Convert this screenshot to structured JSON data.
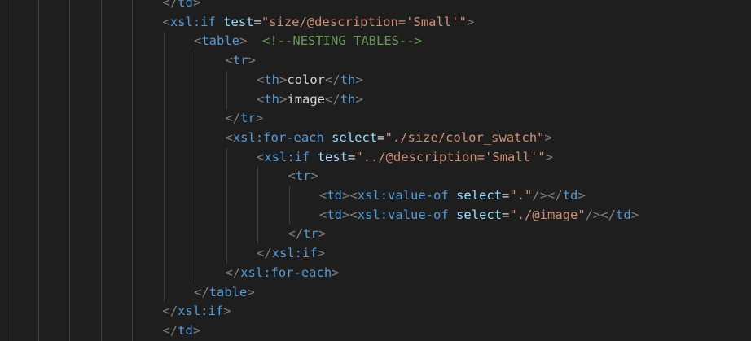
{
  "editor": {
    "language": "xsl",
    "colors": {
      "background": "#1e1e1e",
      "tag": "#569cd6",
      "bracket": "#808080",
      "attribute": "#9cdcfe",
      "string": "#ce9178",
      "comment": "#6a9955",
      "text": "#d4d4d4",
      "indent_guide": "#404040"
    },
    "lines": [
      {
        "indent": 6,
        "tokens": [
          [
            "br",
            "</"
          ],
          [
            "tag",
            "td"
          ],
          [
            "br",
            ">"
          ]
        ]
      },
      {
        "indent": 6,
        "tokens": [
          [
            "br",
            "<"
          ],
          [
            "tag",
            "xsl:if"
          ],
          [
            "txt",
            " "
          ],
          [
            "attr",
            "test"
          ],
          [
            "txt",
            "="
          ],
          [
            "str",
            "\"size/@description='Small'\""
          ],
          [
            "br",
            ">"
          ]
        ]
      },
      {
        "indent": 7,
        "tokens": [
          [
            "br",
            "<"
          ],
          [
            "tag",
            "table"
          ],
          [
            "br",
            ">"
          ],
          [
            "txt",
            "  "
          ],
          [
            "cmt",
            "<!--NESTING TABLES-->"
          ]
        ]
      },
      {
        "indent": 8,
        "tokens": [
          [
            "br",
            "<"
          ],
          [
            "tag",
            "tr"
          ],
          [
            "br",
            ">"
          ]
        ]
      },
      {
        "indent": 9,
        "tokens": [
          [
            "br",
            "<"
          ],
          [
            "tag",
            "th"
          ],
          [
            "br",
            ">"
          ],
          [
            "txt",
            "color"
          ],
          [
            "br",
            "</"
          ],
          [
            "tag",
            "th"
          ],
          [
            "br",
            ">"
          ]
        ]
      },
      {
        "indent": 9,
        "tokens": [
          [
            "br",
            "<"
          ],
          [
            "tag",
            "th"
          ],
          [
            "br",
            ">"
          ],
          [
            "txt",
            "image"
          ],
          [
            "br",
            "</"
          ],
          [
            "tag",
            "th"
          ],
          [
            "br",
            ">"
          ]
        ]
      },
      {
        "indent": 8,
        "tokens": [
          [
            "br",
            "</"
          ],
          [
            "tag",
            "tr"
          ],
          [
            "br",
            ">"
          ]
        ]
      },
      {
        "indent": 8,
        "tokens": [
          [
            "br",
            "<"
          ],
          [
            "tag",
            "xsl:for-each"
          ],
          [
            "txt",
            " "
          ],
          [
            "attr",
            "select"
          ],
          [
            "txt",
            "="
          ],
          [
            "str",
            "\"./size/color_swatch\""
          ],
          [
            "br",
            ">"
          ]
        ]
      },
      {
        "indent": 9,
        "tokens": [
          [
            "br",
            "<"
          ],
          [
            "tag",
            "xsl:if"
          ],
          [
            "txt",
            " "
          ],
          [
            "attr",
            "test"
          ],
          [
            "txt",
            "="
          ],
          [
            "str",
            "\"../@description='Small'\""
          ],
          [
            "br",
            ">"
          ]
        ]
      },
      {
        "indent": 10,
        "tokens": [
          [
            "br",
            "<"
          ],
          [
            "tag",
            "tr"
          ],
          [
            "br",
            ">"
          ]
        ]
      },
      {
        "indent": 11,
        "tokens": [
          [
            "br",
            "<"
          ],
          [
            "tag",
            "td"
          ],
          [
            "br",
            ">"
          ],
          [
            "br",
            "<"
          ],
          [
            "tag",
            "xsl:value-of"
          ],
          [
            "txt",
            " "
          ],
          [
            "attr",
            "select"
          ],
          [
            "txt",
            "="
          ],
          [
            "str",
            "\".\""
          ],
          [
            "br",
            "/>"
          ],
          [
            "br",
            "</"
          ],
          [
            "tag",
            "td"
          ],
          [
            "br",
            ">"
          ]
        ]
      },
      {
        "indent": 11,
        "tokens": [
          [
            "br",
            "<"
          ],
          [
            "tag",
            "td"
          ],
          [
            "br",
            ">"
          ],
          [
            "br",
            "<"
          ],
          [
            "tag",
            "xsl:value-of"
          ],
          [
            "txt",
            " "
          ],
          [
            "attr",
            "select"
          ],
          [
            "txt",
            "="
          ],
          [
            "str",
            "\"./@image\""
          ],
          [
            "br",
            "/>"
          ],
          [
            "br",
            "</"
          ],
          [
            "tag",
            "td"
          ],
          [
            "br",
            ">"
          ]
        ]
      },
      {
        "indent": 10,
        "tokens": [
          [
            "br",
            "</"
          ],
          [
            "tag",
            "tr"
          ],
          [
            "br",
            ">"
          ]
        ]
      },
      {
        "indent": 9,
        "tokens": [
          [
            "br",
            "</"
          ],
          [
            "tag",
            "xsl:if"
          ],
          [
            "br",
            ">"
          ]
        ]
      },
      {
        "indent": 8,
        "tokens": [
          [
            "br",
            "</"
          ],
          [
            "tag",
            "xsl:for-each"
          ],
          [
            "br",
            ">"
          ]
        ]
      },
      {
        "indent": 7,
        "tokens": [
          [
            "br",
            "</"
          ],
          [
            "tag",
            "table"
          ],
          [
            "br",
            ">"
          ]
        ]
      },
      {
        "indent": 6,
        "tokens": [
          [
            "br",
            "</"
          ],
          [
            "tag",
            "xsl:if"
          ],
          [
            "br",
            ">"
          ]
        ]
      },
      {
        "indent": 6,
        "tokens": [
          [
            "br",
            "</"
          ],
          [
            "tag",
            "td"
          ],
          [
            "br",
            ">"
          ]
        ]
      }
    ]
  }
}
